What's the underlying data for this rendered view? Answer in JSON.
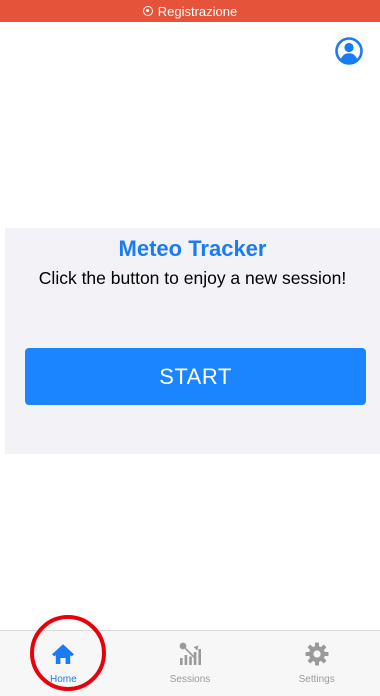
{
  "status_bar": {
    "recording_label": "Registrazione",
    "color": "#e5533a",
    "icon": "record-icon"
  },
  "header": {
    "profile_icon": "user-circle-icon"
  },
  "main": {
    "title": "Meteo Tracker",
    "subtitle": "Click the button to enjoy a new session!",
    "start_button_label": "START",
    "accent_color": "#1a7cf2"
  },
  "tab_bar": {
    "active_tab": "Home",
    "tabs": [
      {
        "label": "Home",
        "icon": "home-icon",
        "active": true
      },
      {
        "label": "Sessions",
        "icon": "chart-bars-icon",
        "active": false
      },
      {
        "label": "Settings",
        "icon": "gear-icon",
        "active": false
      }
    ]
  },
  "annotation": {
    "color": "#e8000b",
    "target": "Home"
  }
}
